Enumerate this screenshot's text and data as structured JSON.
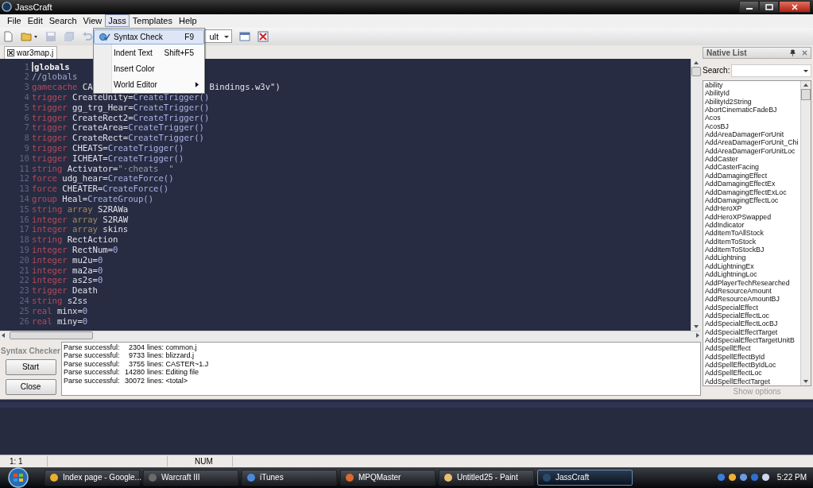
{
  "window": {
    "title": "JassCraft"
  },
  "menubar": [
    {
      "label": "File",
      "selected": false
    },
    {
      "label": "Edit",
      "selected": false
    },
    {
      "label": "Search",
      "selected": false
    },
    {
      "label": "View",
      "selected": false
    },
    {
      "label": "Jass",
      "selected": true
    },
    {
      "label": "Templates",
      "selected": false
    },
    {
      "label": "Help",
      "selected": false
    }
  ],
  "menu": [
    {
      "label": "Syntax Check",
      "shortcut": "F9",
      "icon": true,
      "submenu": false,
      "selected": true
    },
    {
      "label": "Indent Text",
      "shortcut": "Shift+F5",
      "icon": false,
      "submenu": false,
      "selected": false
    },
    {
      "label": "Insert Color",
      "icon": false,
      "submenu": false,
      "selected": false
    },
    {
      "label": "World Editor",
      "icon": false,
      "submenu": true,
      "selected": false
    }
  ],
  "toolbar": {
    "tools": [
      {
        "kind": "new",
        "disabled": false
      },
      {
        "kind": "open",
        "disabled": false
      },
      {
        "kind": "save",
        "disabled": true
      },
      {
        "kind": "save-all",
        "disabled": true
      },
      {
        "kind": "undo",
        "disabled": true
      }
    ],
    "combo": "ult",
    "tools_right": [
      {
        "kind": "window",
        "disabled": false
      },
      {
        "kind": "close-doc",
        "disabled": false
      }
    ]
  },
  "tabs": [
    {
      "label": "war3map.j"
    }
  ],
  "editor": {
    "lines": [
      {
        "n": "1",
        "tokens": [
          {
            "text": "globals",
            "kind": "bold"
          }
        ]
      },
      {
        "n": "2",
        "tokens": [
          {
            "text": "//globals",
            "kind": "comment"
          }
        ]
      },
      {
        "n": "3",
        "tokens": [
          {
            "text": "gamecache",
            "kind": "keyword"
          },
          {
            "text": "CA",
            "kind": "name"
          },
          {
            "text": "Bindings.w3v\")",
            "kind": "name",
            "covered_before": true
          }
        ]
      },
      {
        "n": "4",
        "tokens": [
          {
            "text": "trigger",
            "kind": "keyword"
          },
          {
            "text": "CreateUnity=",
            "kind": "name"
          },
          {
            "text": "CreateTrigger()",
            "kind": "call"
          }
        ]
      },
      {
        "n": "5",
        "tokens": [
          {
            "text": "trigger",
            "kind": "keyword"
          },
          {
            "text": "gg_trg_Hear=",
            "kind": "name"
          },
          {
            "text": "CreateTrigger()",
            "kind": "call"
          }
        ]
      },
      {
        "n": "6",
        "tokens": [
          {
            "text": "trigger",
            "kind": "keyword"
          },
          {
            "text": "CreateRect2=",
            "kind": "name"
          },
          {
            "text": "CreateTrigger()",
            "kind": "call"
          }
        ]
      },
      {
        "n": "7",
        "tokens": [
          {
            "text": "trigger",
            "kind": "keyword"
          },
          {
            "text": "CreateArea=",
            "kind": "name"
          },
          {
            "text": "CreateTrigger()",
            "kind": "call"
          }
        ]
      },
      {
        "n": "8",
        "tokens": [
          {
            "text": "trigger",
            "kind": "keyword"
          },
          {
            "text": "CreateRect=",
            "kind": "name"
          },
          {
            "text": "CreateTrigger()",
            "kind": "call"
          }
        ]
      },
      {
        "n": "9",
        "tokens": [
          {
            "text": "trigger",
            "kind": "keyword"
          },
          {
            "text": "CHEATS=",
            "kind": "name"
          },
          {
            "text": "CreateTrigger()",
            "kind": "call"
          }
        ]
      },
      {
        "n": "10",
        "tokens": [
          {
            "text": "trigger",
            "kind": "keyword"
          },
          {
            "text": "ICHEAT=",
            "kind": "name"
          },
          {
            "text": "CreateTrigger()",
            "kind": "call"
          }
        ]
      },
      {
        "n": "11",
        "tokens": [
          {
            "text": "string",
            "kind": "keyword"
          },
          {
            "text": "Activator=",
            "kind": "name"
          },
          {
            "text": "\"·cheats  \"",
            "kind": "string"
          }
        ]
      },
      {
        "n": "12",
        "tokens": [
          {
            "text": "force",
            "kind": "keyword"
          },
          {
            "text": "udg_hear=",
            "kind": "name"
          },
          {
            "text": "CreateForce()",
            "kind": "call"
          }
        ]
      },
      {
        "n": "13",
        "tokens": [
          {
            "text": "force",
            "kind": "keyword"
          },
          {
            "text": "CHEATER=",
            "kind": "name"
          },
          {
            "text": "CreateForce()",
            "kind": "call"
          }
        ]
      },
      {
        "n": "14",
        "tokens": [
          {
            "text": "group",
            "kind": "keyword"
          },
          {
            "text": "Heal=",
            "kind": "name"
          },
          {
            "text": "CreateGroup()",
            "kind": "call"
          }
        ]
      },
      {
        "n": "15",
        "tokens": [
          {
            "text": "string",
            "kind": "keyword"
          },
          {
            "text": "array",
            "kind": "modifier"
          },
          {
            "text": "S2RAWa",
            "kind": "name"
          }
        ]
      },
      {
        "n": "16",
        "tokens": [
          {
            "text": "integer",
            "kind": "keyword"
          },
          {
            "text": "array",
            "kind": "modifier"
          },
          {
            "text": "S2RAW",
            "kind": "name"
          }
        ]
      },
      {
        "n": "17",
        "tokens": [
          {
            "text": "integer",
            "kind": "keyword"
          },
          {
            "text": "array",
            "kind": "modifier"
          },
          {
            "text": "skins",
            "kind": "name"
          }
        ]
      },
      {
        "n": "18",
        "tokens": [
          {
            "text": "string",
            "kind": "keyword"
          },
          {
            "text": "RectAction",
            "kind": "name"
          }
        ]
      },
      {
        "n": "19",
        "tokens": [
          {
            "text": "integer",
            "kind": "keyword"
          },
          {
            "text": "RectNum=",
            "kind": "name"
          },
          {
            "text": "0",
            "kind": "call"
          }
        ]
      },
      {
        "n": "20",
        "tokens": [
          {
            "text": "integer",
            "kind": "keyword"
          },
          {
            "text": "mu2u=",
            "kind": "name"
          },
          {
            "text": "0",
            "kind": "call"
          }
        ]
      },
      {
        "n": "21",
        "tokens": [
          {
            "text": "integer",
            "kind": "keyword"
          },
          {
            "text": "ma2a=",
            "kind": "name"
          },
          {
            "text": "0",
            "kind": "call"
          }
        ]
      },
      {
        "n": "22",
        "tokens": [
          {
            "text": "integer",
            "kind": "keyword"
          },
          {
            "text": "as2s=",
            "kind": "name"
          },
          {
            "text": "0",
            "kind": "call"
          }
        ]
      },
      {
        "n": "23",
        "tokens": [
          {
            "text": "trigger",
            "kind": "keyword"
          },
          {
            "text": "Death",
            "kind": "name"
          }
        ]
      },
      {
        "n": "24",
        "tokens": [
          {
            "text": "string",
            "kind": "keyword"
          },
          {
            "text": "s2ss",
            "kind": "name"
          }
        ]
      },
      {
        "n": "25",
        "tokens": [
          {
            "text": "real",
            "kind": "keyword"
          },
          {
            "text": "minx=",
            "kind": "name"
          },
          {
            "text": "0",
            "kind": "call"
          }
        ]
      },
      {
        "n": "26",
        "tokens": [
          {
            "text": "real",
            "kind": "keyword"
          },
          {
            "text": "miny=",
            "kind": "name"
          },
          {
            "text": "0",
            "kind": "call"
          }
        ]
      }
    ]
  },
  "syntax_checker": {
    "title": "Syntax Checker",
    "buttons": [
      "Start",
      "Close"
    ],
    "output": [
      {
        "status": "Parse successful:",
        "count": "2304",
        "detail": "lines: common.j"
      },
      {
        "status": "Parse successful:",
        "count": "9733",
        "detail": "lines: blizzard.j"
      },
      {
        "status": "Parse successful:",
        "count": "3755",
        "detail": "lines: CASTER~1.J"
      },
      {
        "status": "Parse successful:",
        "count": "14280",
        "detail": "lines: Editing file"
      },
      {
        "status": "Parse successful:",
        "count": "30072",
        "detail": "lines: <total>"
      }
    ]
  },
  "native_list": {
    "title": "Native List",
    "search_label": "Search:",
    "items": [
      "ability",
      "AbilityId",
      "AbilityId2String",
      "AbortCinematicFadeBJ",
      "Acos",
      "AcosBJ",
      "AddAreaDamagerForUnit",
      "AddAreaDamagerForUnit_Chi",
      "AddAreaDamagerForUnitLoc",
      "AddCaster",
      "AddCasterFacing",
      "AddDamagingEffect",
      "AddDamagingEffectEx",
      "AddDamagingEffectExLoc",
      "AddDamagingEffectLoc",
      "AddHeroXP",
      "AddHeroXPSwapped",
      "AddIndicator",
      "AddItemToAllStock",
      "AddItemToStock",
      "AddItemToStockBJ",
      "AddLightning",
      "AddLightningEx",
      "AddLightningLoc",
      "AddPlayerTechResearched",
      "AddResourceAmount",
      "AddResourceAmountBJ",
      "AddSpecialEffect",
      "AddSpecialEffectLoc",
      "AddSpecialEffectLocBJ",
      "AddSpecialEffectTarget",
      "AddSpecialEffectTargetUnitB",
      "AddSpellEffect",
      "AddSpellEffectById",
      "AddSpellEffectByIdLoc",
      "AddSpellEffectLoc",
      "AddSpellEffectTarget"
    ],
    "show_options": {
      "label": "Show options",
      "disabled": true
    }
  },
  "status_bar": {
    "position": "1: 1",
    "num": "NUM"
  },
  "taskbar": {
    "items": [
      {
        "label": "Index page - Google...",
        "selected": false
      },
      {
        "label": "Warcraft III",
        "selected": false
      },
      {
        "label": "iTunes",
        "selected": false
      },
      {
        "label": "MPQMaster",
        "selected": false
      },
      {
        "label": "Untitled25 - Paint",
        "selected": false
      },
      {
        "label": "JassCraft",
        "selected": true
      }
    ],
    "clock": "5:22 PM"
  }
}
